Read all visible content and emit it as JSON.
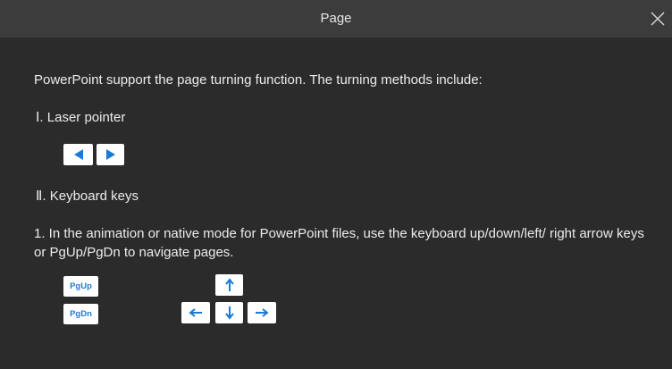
{
  "dialog": {
    "title": "Page",
    "close_icon": "close-icon"
  },
  "content": {
    "intro": "PowerPoint support the page turning function. The turning methods include:",
    "section1": {
      "heading": "Ⅰ. Laser pointer",
      "keys": [
        "left-triangle-icon",
        "right-triangle-icon"
      ]
    },
    "section2": {
      "heading": "Ⅱ. Keyboard keys",
      "description": "1. In the animation or native mode for PowerPoint files, use the keyboard up/down/left/ right arrow keys or PgUp/PgDn to navigate pages.",
      "page_keys": [
        "PgUp",
        "PgDn"
      ],
      "arrow_keys": [
        "arrow-up-icon",
        "arrow-left-icon",
        "arrow-down-icon",
        "arrow-right-icon"
      ]
    }
  },
  "colors": {
    "background": "#2b2b2b",
    "titlebar": "#3c3c3c",
    "text": "#ececec",
    "key_background": "#ffffff",
    "key_accent": "#1f7ad1"
  }
}
